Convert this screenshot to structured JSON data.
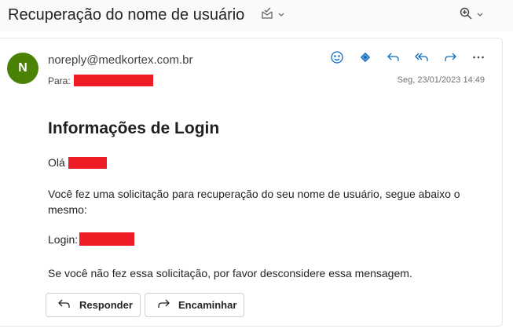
{
  "header": {
    "subject": "Recuperação do nome de usuário"
  },
  "message": {
    "avatar_initial": "N",
    "sender": "noreply@medkortex.com.br",
    "to_label": "Para:",
    "date": "Seg, 23/01/2023 14:49"
  },
  "body": {
    "title": "Informações de Login",
    "greeting": "Olá",
    "request_text": "Você fez uma solicitação para recuperação do seu nome de usuário, segue abaixo o mesmo:",
    "login_label": "Login:",
    "ignore_text": "Se você não fez essa solicitação, por favor desconsidere essa mensagem."
  },
  "buttons": {
    "reply_label": "Responder",
    "forward_label": "Encaminhar"
  },
  "colors": {
    "accent": "#0f6cbd",
    "avatar": "#498205",
    "redaction": "#ee1c24"
  },
  "icons": [
    "mark-read-icon",
    "zoom-icon",
    "emoji-icon",
    "loop-icon",
    "reply-icon",
    "reply-all-icon",
    "forward-icon",
    "more-icon"
  ]
}
